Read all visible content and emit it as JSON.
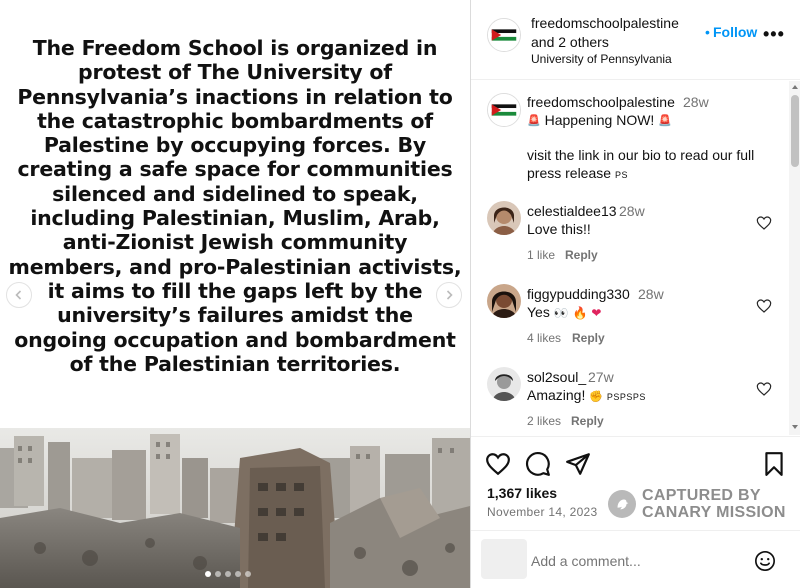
{
  "post": {
    "text": "The Freedom School is organized in protest of The University of Pennsylvania’s inactions in relation to the catastrophic bombardments of Palestine by occupying forces. By creating a safe space for communities silenced and sidelined to speak, including Palestinian, Muslim, Arab, anti-Zionist Jewish community members, and pro-Palestinian activists, it aims to fill the gaps left by the university’s failures amidst the ongoing occupation and bombardment of the Palestinian territories.",
    "carousel_count": 5,
    "carousel_active_index": 0
  },
  "header": {
    "username": "freedomschoolpalestine",
    "and_others": "and 2 others",
    "location": "University of Pennsylvania",
    "dot": "•",
    "follow_label": "Follow",
    "more_label": "•••"
  },
  "caption": {
    "username": "freedomschoolpalestine",
    "time": "28w",
    "line1": "Happening NOW!",
    "line2": "visit the link in our bio to read our full press release",
    "line2_tag": "PS"
  },
  "comments": [
    {
      "username": "celestialdee13",
      "time": "28w",
      "text": "Love this!!",
      "likes": "1 like",
      "reply": "Reply"
    },
    {
      "username": "figgypudding330",
      "time": "28w",
      "text": "Yes",
      "likes": "4 likes",
      "reply": "Reply"
    },
    {
      "username": "sol2soul_",
      "time": "27w",
      "text": "Amazing!",
      "text_tag": "PSPSPS",
      "likes": "2 likes",
      "reply": "Reply"
    }
  ],
  "actions": {
    "likes": "1,367 likes",
    "date": "November 14, 2023"
  },
  "watermark": {
    "line1": "CAPTURED BY",
    "line2": "CANARY MISSION"
  },
  "add_comment": {
    "placeholder": "Add a comment..."
  },
  "colors": {
    "link_blue": "#0095f6",
    "muted": "#737373",
    "border": "#dbdbdb"
  },
  "icons": [
    "chevron-left-icon",
    "chevron-right-icon",
    "heart-icon",
    "comment-icon",
    "share-icon",
    "bookmark-icon",
    "emoji-icon",
    "canary-logo-icon",
    "siren-icon"
  ]
}
